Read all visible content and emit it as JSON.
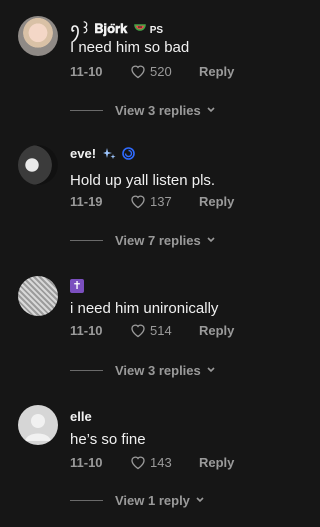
{
  "comments": [
    {
      "user": "ꪆ꒱ 𝐁𝐣𝐨̈𝐫𝐤",
      "user_suffix": "PS",
      "text": "I need him so bad",
      "date": "11-10",
      "likes": "520",
      "reply": "Reply",
      "view_replies": "View 3 replies"
    },
    {
      "user": "eve!",
      "text": "Hold up yall listen pls.",
      "date": "11-19",
      "likes": "137",
      "reply": "Reply",
      "view_replies": "View 7 replies"
    },
    {
      "user": "",
      "user_symbol": "✝",
      "text": "i need him unironically",
      "date": "11-10",
      "likes": "514",
      "reply": "Reply",
      "view_replies": "View 3 replies"
    },
    {
      "user": "elle",
      "text": "he’s so fine",
      "date": "11-10",
      "likes": "143",
      "reply": "Reply",
      "view_replies": "View 1 reply"
    }
  ],
  "colors": {
    "background": "#161616",
    "muted": "#9a9a9a",
    "badge_purple": "#7b4fbf",
    "swirl_blue": "#2f6bff"
  },
  "icons": [
    "watermelon-icon",
    "heart-icon",
    "chevron-down-icon",
    "sparkles-icon",
    "swirl-icon",
    "cross-icon"
  ]
}
